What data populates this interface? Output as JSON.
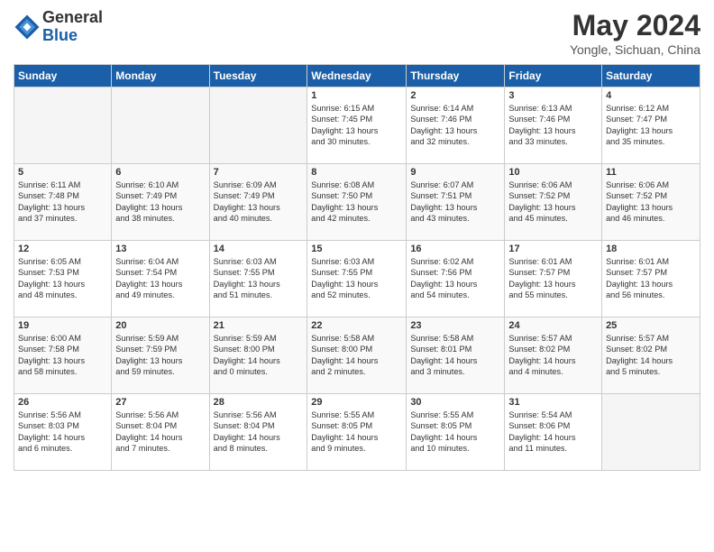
{
  "header": {
    "logo_general": "General",
    "logo_blue": "Blue",
    "month_year": "May 2024",
    "location": "Yongle, Sichuan, China"
  },
  "weekdays": [
    "Sunday",
    "Monday",
    "Tuesday",
    "Wednesday",
    "Thursday",
    "Friday",
    "Saturday"
  ],
  "weeks": [
    [
      {
        "day": "",
        "info": ""
      },
      {
        "day": "",
        "info": ""
      },
      {
        "day": "",
        "info": ""
      },
      {
        "day": "1",
        "info": "Sunrise: 6:15 AM\nSunset: 7:45 PM\nDaylight: 13 hours\nand 30 minutes."
      },
      {
        "day": "2",
        "info": "Sunrise: 6:14 AM\nSunset: 7:46 PM\nDaylight: 13 hours\nand 32 minutes."
      },
      {
        "day": "3",
        "info": "Sunrise: 6:13 AM\nSunset: 7:46 PM\nDaylight: 13 hours\nand 33 minutes."
      },
      {
        "day": "4",
        "info": "Sunrise: 6:12 AM\nSunset: 7:47 PM\nDaylight: 13 hours\nand 35 minutes."
      }
    ],
    [
      {
        "day": "5",
        "info": "Sunrise: 6:11 AM\nSunset: 7:48 PM\nDaylight: 13 hours\nand 37 minutes."
      },
      {
        "day": "6",
        "info": "Sunrise: 6:10 AM\nSunset: 7:49 PM\nDaylight: 13 hours\nand 38 minutes."
      },
      {
        "day": "7",
        "info": "Sunrise: 6:09 AM\nSunset: 7:49 PM\nDaylight: 13 hours\nand 40 minutes."
      },
      {
        "day": "8",
        "info": "Sunrise: 6:08 AM\nSunset: 7:50 PM\nDaylight: 13 hours\nand 42 minutes."
      },
      {
        "day": "9",
        "info": "Sunrise: 6:07 AM\nSunset: 7:51 PM\nDaylight: 13 hours\nand 43 minutes."
      },
      {
        "day": "10",
        "info": "Sunrise: 6:06 AM\nSunset: 7:52 PM\nDaylight: 13 hours\nand 45 minutes."
      },
      {
        "day": "11",
        "info": "Sunrise: 6:06 AM\nSunset: 7:52 PM\nDaylight: 13 hours\nand 46 minutes."
      }
    ],
    [
      {
        "day": "12",
        "info": "Sunrise: 6:05 AM\nSunset: 7:53 PM\nDaylight: 13 hours\nand 48 minutes."
      },
      {
        "day": "13",
        "info": "Sunrise: 6:04 AM\nSunset: 7:54 PM\nDaylight: 13 hours\nand 49 minutes."
      },
      {
        "day": "14",
        "info": "Sunrise: 6:03 AM\nSunset: 7:55 PM\nDaylight: 13 hours\nand 51 minutes."
      },
      {
        "day": "15",
        "info": "Sunrise: 6:03 AM\nSunset: 7:55 PM\nDaylight: 13 hours\nand 52 minutes."
      },
      {
        "day": "16",
        "info": "Sunrise: 6:02 AM\nSunset: 7:56 PM\nDaylight: 13 hours\nand 54 minutes."
      },
      {
        "day": "17",
        "info": "Sunrise: 6:01 AM\nSunset: 7:57 PM\nDaylight: 13 hours\nand 55 minutes."
      },
      {
        "day": "18",
        "info": "Sunrise: 6:01 AM\nSunset: 7:57 PM\nDaylight: 13 hours\nand 56 minutes."
      }
    ],
    [
      {
        "day": "19",
        "info": "Sunrise: 6:00 AM\nSunset: 7:58 PM\nDaylight: 13 hours\nand 58 minutes."
      },
      {
        "day": "20",
        "info": "Sunrise: 5:59 AM\nSunset: 7:59 PM\nDaylight: 13 hours\nand 59 minutes."
      },
      {
        "day": "21",
        "info": "Sunrise: 5:59 AM\nSunset: 8:00 PM\nDaylight: 14 hours\nand 0 minutes."
      },
      {
        "day": "22",
        "info": "Sunrise: 5:58 AM\nSunset: 8:00 PM\nDaylight: 14 hours\nand 2 minutes."
      },
      {
        "day": "23",
        "info": "Sunrise: 5:58 AM\nSunset: 8:01 PM\nDaylight: 14 hours\nand 3 minutes."
      },
      {
        "day": "24",
        "info": "Sunrise: 5:57 AM\nSunset: 8:02 PM\nDaylight: 14 hours\nand 4 minutes."
      },
      {
        "day": "25",
        "info": "Sunrise: 5:57 AM\nSunset: 8:02 PM\nDaylight: 14 hours\nand 5 minutes."
      }
    ],
    [
      {
        "day": "26",
        "info": "Sunrise: 5:56 AM\nSunset: 8:03 PM\nDaylight: 14 hours\nand 6 minutes."
      },
      {
        "day": "27",
        "info": "Sunrise: 5:56 AM\nSunset: 8:04 PM\nDaylight: 14 hours\nand 7 minutes."
      },
      {
        "day": "28",
        "info": "Sunrise: 5:56 AM\nSunset: 8:04 PM\nDaylight: 14 hours\nand 8 minutes."
      },
      {
        "day": "29",
        "info": "Sunrise: 5:55 AM\nSunset: 8:05 PM\nDaylight: 14 hours\nand 9 minutes."
      },
      {
        "day": "30",
        "info": "Sunrise: 5:55 AM\nSunset: 8:05 PM\nDaylight: 14 hours\nand 10 minutes."
      },
      {
        "day": "31",
        "info": "Sunrise: 5:54 AM\nSunset: 8:06 PM\nDaylight: 14 hours\nand 11 minutes."
      },
      {
        "day": "",
        "info": ""
      }
    ]
  ]
}
